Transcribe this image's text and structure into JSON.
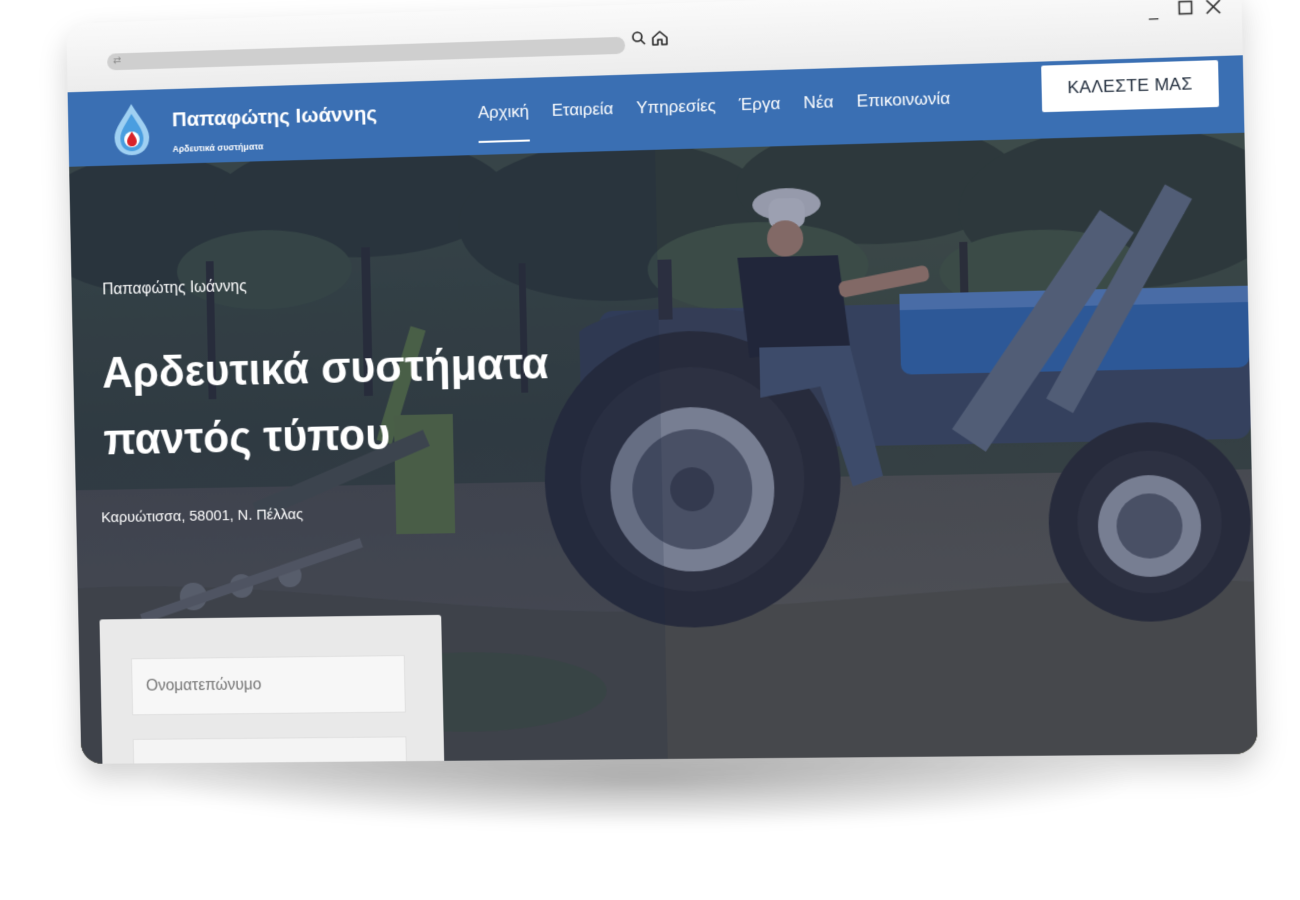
{
  "site": {
    "brand_title": "Παπαφώτης Ιωάννης",
    "brand_subtitle": "Αρδευτικά συστήματα",
    "menu": [
      {
        "label": "Αρχική",
        "active": true
      },
      {
        "label": "Εταιρεία",
        "active": false
      },
      {
        "label": "Υπηρεσίες",
        "active": false
      },
      {
        "label": "Έργα",
        "active": false
      },
      {
        "label": "Νέα",
        "active": false
      },
      {
        "label": "Επικοινωνία",
        "active": false
      }
    ],
    "call_button": "ΚΑΛΕΣΤΕ ΜΑΣ"
  },
  "hero": {
    "kicker": "Παπαφώτης Ιωάννης",
    "title_line1": "Αρδευτικά συστήματα",
    "title_line2": "παντός τύπου",
    "address": "Καρυώτισσα, 58001, Ν. Πέλλας"
  },
  "form": {
    "name_placeholder": "Ονοματεπώνυμο"
  },
  "colors": {
    "nav_blue": "#3a6fb3",
    "tractor_blue": "#2f6fb8",
    "overlay": "#2a3560"
  },
  "icons": [
    "search-icon",
    "home-icon",
    "minimize-icon",
    "maximize-icon",
    "close-icon",
    "water-drop-logo-icon"
  ]
}
